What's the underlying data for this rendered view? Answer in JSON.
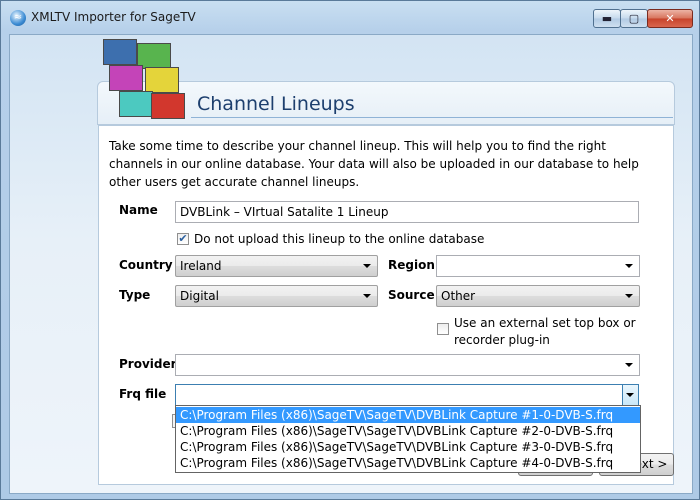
{
  "window": {
    "title": "XMLTV Importer for SageTV",
    "buttons": {
      "minimize": "▬",
      "maximize": "▢",
      "close": "✕"
    }
  },
  "page": {
    "title": "Channel Lineups",
    "description": "Take some time to describe your channel lineup. This will help you to find the right channels in our online database. Your data will also be uploaded in our database to help other users get accurate channel lineups."
  },
  "form": {
    "name_label": "Name",
    "name_value": "DVBLink – VIrtual Satalite 1 Lineup",
    "no_upload_label": "Do not upload this lineup to the online database",
    "no_upload_checked": true,
    "country_label": "Country",
    "country_value": "Ireland",
    "region_label": "Region",
    "region_value": "",
    "type_label": "Type",
    "type_value": "Digital",
    "source_label": "Source",
    "source_value": "Other",
    "external_box_label_line1": "Use an external set top box or",
    "external_box_label_line2": "recorder plug-in",
    "external_box_checked": false,
    "provider_label": "Provider",
    "provider_value": "",
    "frq_label": "Frq file",
    "frq_value": ""
  },
  "frq_options": [
    "C:\\Program Files (x86)\\SageTV\\SageTV\\DVBLink Capture #1-0-DVB-S.frq",
    "C:\\Program Files (x86)\\SageTV\\SageTV\\DVBLink Capture #2-0-DVB-S.frq",
    "C:\\Program Files (x86)\\SageTV\\SageTV\\DVBLink Capture #3-0-DVB-S.frq",
    "C:\\Program Files (x86)\\SageTV\\SageTV\\DVBLink Capture #4-0-DVB-S.frq"
  ],
  "frq_selected_index": 0,
  "footer": {
    "next_label": "Next >"
  },
  "colors": {
    "accent": "#3399ff",
    "title": "#1d3f6e"
  }
}
